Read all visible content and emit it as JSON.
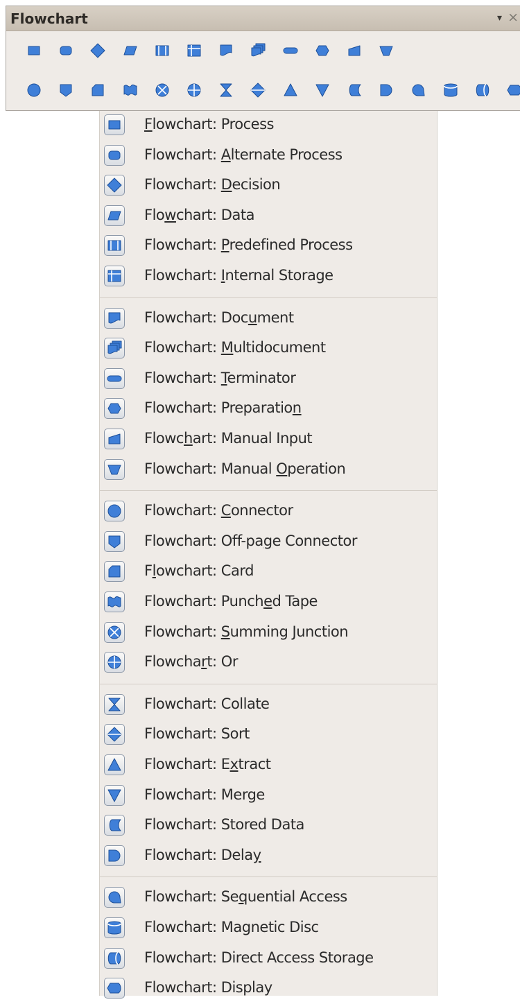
{
  "toolbar": {
    "title": "Flowchart",
    "menu_glyph": "▾",
    "close_glyph": "×",
    "row1": [
      "process",
      "alternate-process",
      "decision",
      "data",
      "predefined-process",
      "internal-storage",
      "document",
      "multidocument",
      "terminator",
      "preparation",
      "manual-input",
      "manual-operation"
    ],
    "row2": [
      "connector",
      "off-page-connector",
      "card",
      "punched-tape",
      "summing-junction",
      "or",
      "collate",
      "sort",
      "extract",
      "merge",
      "stored-data",
      "delay",
      "sequential-access",
      "magnetic-disc",
      "direct-access-storage",
      "display"
    ]
  },
  "menu": {
    "items": [
      {
        "shape": "process",
        "pre": "",
        "key": "F",
        "post": "lowchart: Process"
      },
      {
        "shape": "alternate-process",
        "pre": "Flowchart: ",
        "key": "A",
        "post": "lternate Process"
      },
      {
        "shape": "decision",
        "pre": "Flowchart: ",
        "key": "D",
        "post": "ecision"
      },
      {
        "shape": "data",
        "pre": "Flo",
        "key": "w",
        "post": "chart: Data"
      },
      {
        "shape": "predefined-process",
        "pre": "Flowchart: ",
        "key": "P",
        "post": "redefined Process"
      },
      {
        "shape": "internal-storage",
        "pre": "Flowchart: ",
        "key": "I",
        "post": "nternal Storage"
      },
      {
        "shape": "document",
        "pre": "Flowchart: Doc",
        "key": "u",
        "post": "ment"
      },
      {
        "shape": "multidocument",
        "pre": "Flowchart: ",
        "key": "M",
        "post": "ultidocument"
      },
      {
        "shape": "terminator",
        "pre": "Flowchart: ",
        "key": "T",
        "post": "erminator"
      },
      {
        "shape": "preparation",
        "pre": "Flowchart: Preparatio",
        "key": "n",
        "post": ""
      },
      {
        "shape": "manual-input",
        "pre": "Flowc",
        "key": "h",
        "post": "art: Manual Input"
      },
      {
        "shape": "manual-operation",
        "pre": "Flowchart: Manual ",
        "key": "O",
        "post": "peration"
      },
      {
        "shape": "connector",
        "pre": "Flowchart: ",
        "key": "C",
        "post": "onnector"
      },
      {
        "shape": "off-page-connector",
        "pre": "Flowchart: Off-pa",
        "key": "g",
        "post": "e Connector"
      },
      {
        "shape": "card",
        "pre": "F",
        "key": "l",
        "post": "owchart: Card"
      },
      {
        "shape": "punched-tape",
        "pre": "Flowchart: Punch",
        "key": "e",
        "post": "d Tape"
      },
      {
        "shape": "summing-junction",
        "pre": "Flowchart: ",
        "key": "S",
        "post": "umming Junction"
      },
      {
        "shape": "or",
        "pre": "Flowcha",
        "key": "r",
        "post": "t: Or"
      },
      {
        "shape": "collate",
        "pre": "Flowchart: Collate",
        "key": "",
        "post": ""
      },
      {
        "shape": "sort",
        "pre": "Flowchart: Sort",
        "key": "",
        "post": ""
      },
      {
        "shape": "extract",
        "pre": "Flowchart: E",
        "key": "x",
        "post": "tract"
      },
      {
        "shape": "merge",
        "pre": "Flowchart: Merge",
        "key": "",
        "post": ""
      },
      {
        "shape": "stored-data",
        "pre": "Flowchart: Stored Data",
        "key": "",
        "post": ""
      },
      {
        "shape": "delay",
        "pre": "Flowchart: Dela",
        "key": "y",
        "post": ""
      },
      {
        "shape": "sequential-access",
        "pre": "Flowchart: Se",
        "key": "q",
        "post": "uential Access"
      },
      {
        "shape": "magnetic-disc",
        "pre": "Flowchart: Magnetic Disc",
        "key": "",
        "post": ""
      },
      {
        "shape": "direct-access-storage",
        "pre": "Flowchart: Direct Access Storage",
        "key": "",
        "post": ""
      },
      {
        "shape": "display",
        "pre": "Flowchart: Display",
        "key": "",
        "post": ""
      }
    ]
  },
  "colors": {
    "shape_fill": "#3f7fd8",
    "shape_stroke": "#1d4f98",
    "panel_bg": "#efebe7"
  }
}
